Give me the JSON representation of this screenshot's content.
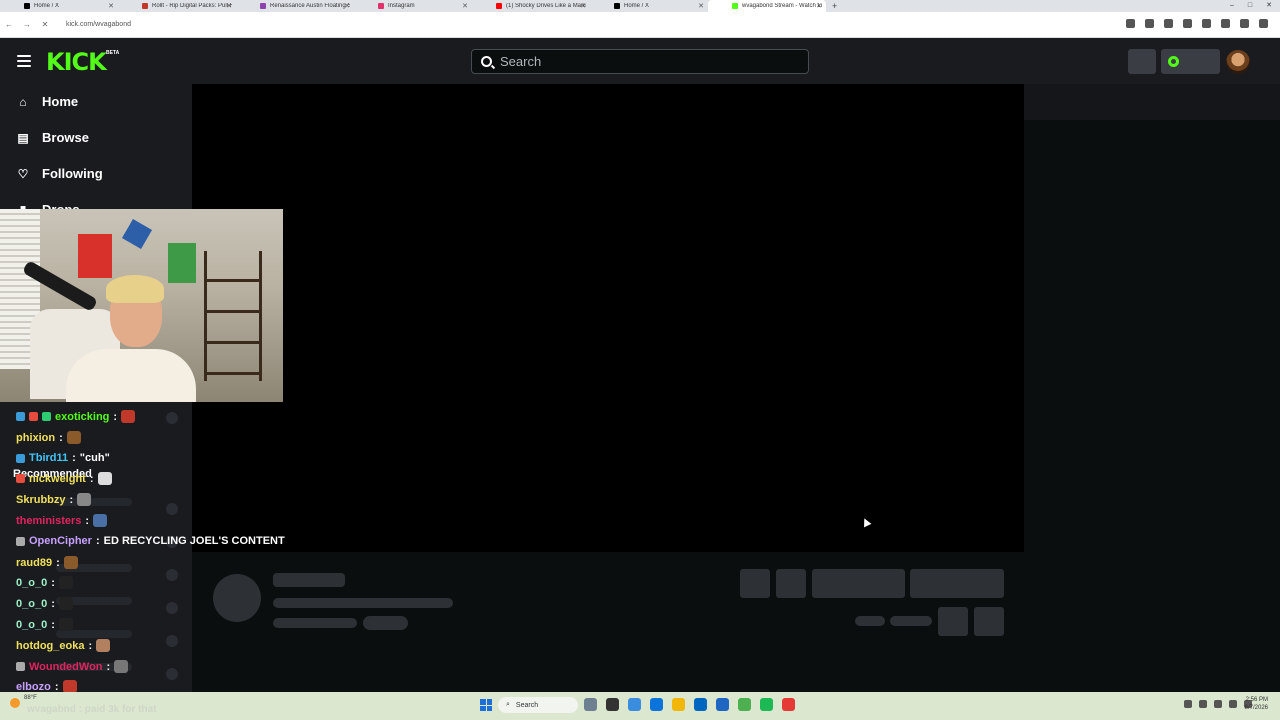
{
  "browser": {
    "tabs": [
      {
        "label": "Home / X",
        "color": "#000000"
      },
      {
        "label": "Rollt - Rip Digital Packs: Pull Re",
        "color": "#c0392b"
      },
      {
        "label": "Renaissance Austin Floating Se",
        "color": "#8e44ad"
      },
      {
        "label": "Instagram",
        "color": "#e1306c"
      },
      {
        "label": "(1) Shocky Drives Like a Mania",
        "color": "#ff0000"
      },
      {
        "label": "Home / X",
        "color": "#000000"
      },
      {
        "label": "wvagabond Stream - Watch Liv",
        "color": "#53fc18"
      }
    ],
    "new_tab": "+",
    "url": "kick.com/wvagabond"
  },
  "kick": {
    "logo": "KICK",
    "beta": "BETA",
    "search_placeholder": "Search",
    "nav": [
      {
        "label": "Home",
        "icon": "house-icon"
      },
      {
        "label": "Browse",
        "icon": "browse-icon"
      },
      {
        "label": "Following",
        "icon": "heart-icon"
      },
      {
        "label": "Drops",
        "icon": "drops-icon"
      }
    ],
    "recommended_label": "Recommended"
  },
  "chat": [
    {
      "user": "exoticking",
      "color": "#53fc18",
      "text": "",
      "badges": [
        "#3b9bd8",
        "#e74c3c",
        "#2ecc71"
      ],
      "emote": "#c0392b"
    },
    {
      "user": "phixion",
      "color": "#f1e05a",
      "text": "",
      "badges": [],
      "emote": "#8b5a2b"
    },
    {
      "user": "Tbird11",
      "color": "#3ec6ff",
      "text": "\"cuh\"",
      "badges": [
        "#3b9bd8"
      ],
      "emote": ""
    },
    {
      "user": "nickweight",
      "color": "#f1e05a",
      "text": "",
      "badges": [
        "#e74c3c"
      ],
      "emote": "#dddddd"
    },
    {
      "user": "Skrubbzy",
      "color": "#f1e05a",
      "text": "",
      "badges": [],
      "emote": "#888888"
    },
    {
      "user": "theministers",
      "color": "#e0245e",
      "text": "",
      "badges": [],
      "emote": "#4a6fa5"
    },
    {
      "user": "OpenCipher",
      "color": "#c9a0ff",
      "text": "ED RECYCLING JOEL'S CONTENT",
      "badges": [
        "#aaaaaa"
      ],
      "emote": ""
    },
    {
      "user": "raud89",
      "color": "#f1e05a",
      "text": "",
      "badges": [],
      "emote": "#8b5a2b"
    },
    {
      "user": "0_o_0",
      "color": "#9ef0c7",
      "text": "",
      "badges": [],
      "emote": "#222222"
    },
    {
      "user": "0_o_0",
      "color": "#9ef0c7",
      "text": "",
      "badges": [],
      "emote": "#222222"
    },
    {
      "user": "0_o_0",
      "color": "#9ef0c7",
      "text": "",
      "badges": [],
      "emote": "#222222"
    },
    {
      "user": "hotdog_eoka",
      "color": "#f1e05a",
      "text": "",
      "badges": [],
      "emote": "#b08060"
    },
    {
      "user": "WoundedWon",
      "color": "#e0245e",
      "text": "",
      "badges": [
        "#aaaaaa"
      ],
      "emote": "#777777"
    },
    {
      "user": "elbozo",
      "color": "#c9a0ff",
      "text": "",
      "badges": [],
      "emote": "#c0392b"
    }
  ],
  "ghost_chat": "wvagabnd : paid 3k for that",
  "taskbar": {
    "search": "Search",
    "temp": "88°F",
    "time": "2:56 PM",
    "date": "8/7/2026",
    "icons": [
      "#6e7f92",
      "#333333",
      "#3a8dde",
      "#0a74da",
      "#f2b705",
      "#0067c0",
      "#1e66c1",
      "#4caf50",
      "#1db954",
      "#e53935"
    ]
  },
  "colors": {
    "accent": "#53fc18",
    "bg": "#0b0e0f",
    "nav": "#191b1f"
  }
}
